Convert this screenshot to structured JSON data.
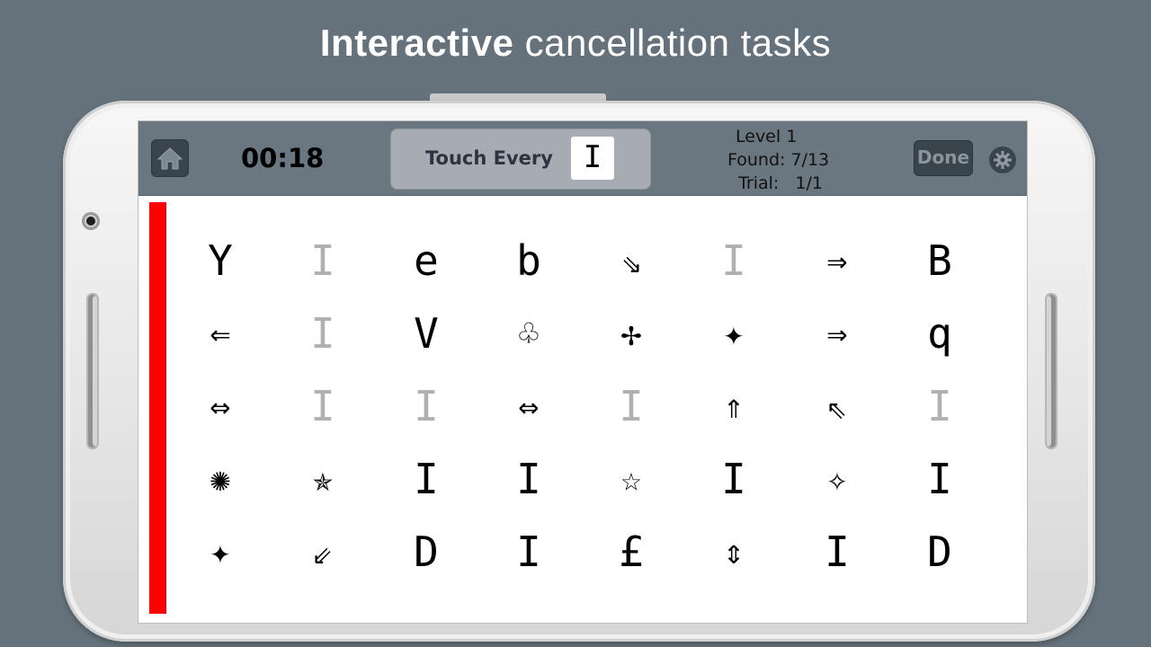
{
  "headline": {
    "bold": "Interactive",
    "rest": " cancellation tasks"
  },
  "timer": "00:18",
  "target": {
    "label": "Touch Every",
    "symbol": "I"
  },
  "status": {
    "level": "Level 1",
    "found": "Found: 7/13",
    "trial": "  Trial:   1/1"
  },
  "done_label": "Done",
  "icons": {
    "home": "home-icon",
    "settings": "gear-icon"
  },
  "colors": {
    "topbar": "#6a7781",
    "progress_bar": "#ff0000",
    "found_symbol": "#b0b0b0"
  },
  "grid": [
    [
      {
        "s": "Y",
        "f": false
      },
      {
        "s": "I",
        "f": true
      },
      {
        "s": "e",
        "f": false
      },
      {
        "s": "b",
        "f": false
      },
      {
        "s": "⇘",
        "f": false
      },
      {
        "s": "I",
        "f": true
      },
      {
        "s": "⇒",
        "f": false
      },
      {
        "s": "B",
        "f": false
      }
    ],
    [
      {
        "s": "⇐",
        "f": false
      },
      {
        "s": "I",
        "f": true
      },
      {
        "s": "V",
        "f": false
      },
      {
        "s": "♧",
        "f": false
      },
      {
        "s": "✢",
        "f": false
      },
      {
        "s": "✦",
        "f": false
      },
      {
        "s": "⇒",
        "f": false
      },
      {
        "s": "q",
        "f": false
      }
    ],
    [
      {
        "s": "⇔",
        "f": false
      },
      {
        "s": "I",
        "f": true
      },
      {
        "s": "I",
        "f": true
      },
      {
        "s": "⇔",
        "f": false
      },
      {
        "s": "I",
        "f": true
      },
      {
        "s": "⇑",
        "f": false
      },
      {
        "s": "⇖",
        "f": false
      },
      {
        "s": "I",
        "f": true
      }
    ],
    [
      {
        "s": "✺",
        "f": false
      },
      {
        "s": "✯",
        "f": false
      },
      {
        "s": "I",
        "f": false
      },
      {
        "s": "I",
        "f": false
      },
      {
        "s": "☆",
        "f": false
      },
      {
        "s": "I",
        "f": false
      },
      {
        "s": "✧",
        "f": false
      },
      {
        "s": "I",
        "f": false
      }
    ],
    [
      {
        "s": "✦",
        "f": false
      },
      {
        "s": "⇙",
        "f": false
      },
      {
        "s": "D",
        "f": false
      },
      {
        "s": "I",
        "f": false
      },
      {
        "s": "£",
        "f": false
      },
      {
        "s": "⇕",
        "f": false
      },
      {
        "s": "I",
        "f": false
      },
      {
        "s": "D",
        "f": false
      }
    ]
  ]
}
